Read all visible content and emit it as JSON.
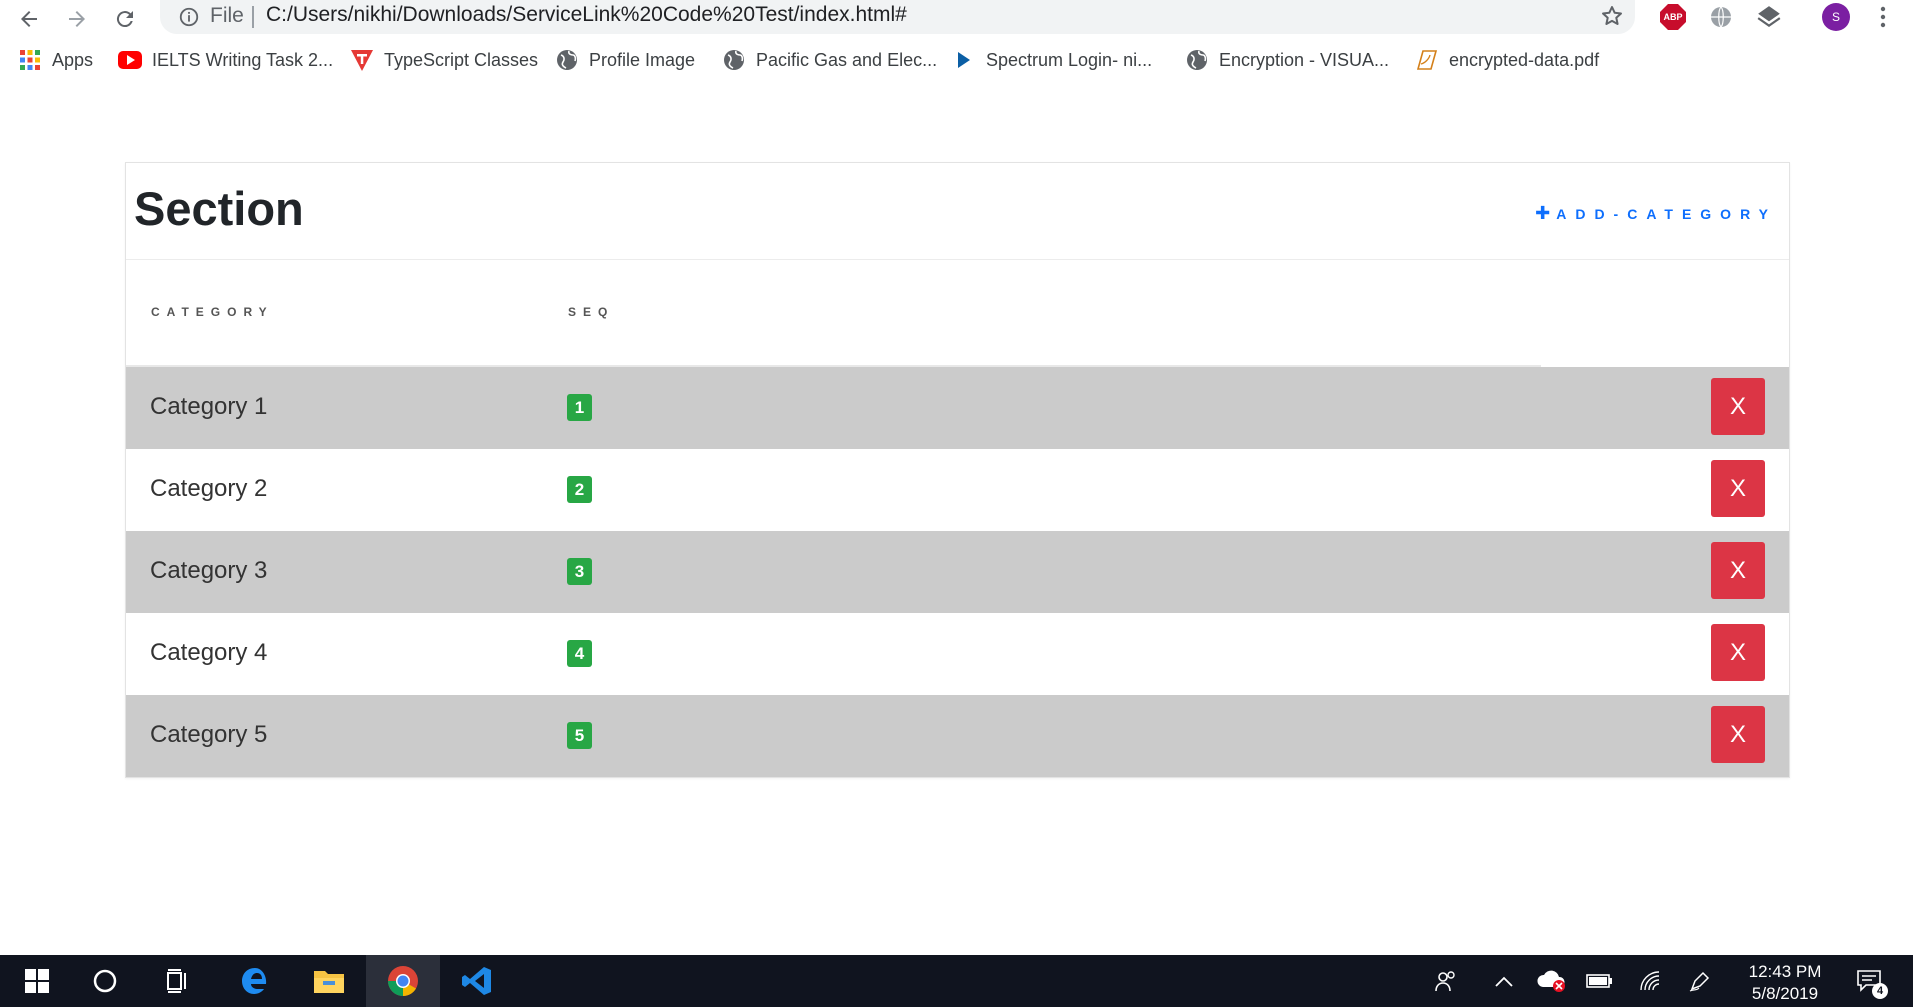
{
  "browser": {
    "file_label": "File",
    "url": "C:/Users/nikhi/Downloads/ServiceLink%20Code%20Test/index.html#",
    "extensions": {
      "abp_label": "ABP",
      "profile_initial": "S"
    }
  },
  "bookmarks": [
    {
      "label": "Apps",
      "icon": "apps-grid-icon"
    },
    {
      "label": "IELTS Writing Task 2...",
      "icon": "youtube-icon"
    },
    {
      "label": "TypeScript Classes",
      "icon": "typescript-t-icon"
    },
    {
      "label": "Profile Image",
      "icon": "globe-icon"
    },
    {
      "label": "Pacific Gas and Elec...",
      "icon": "globe-icon"
    },
    {
      "label": "Spectrum Login- ni...",
      "icon": "play-arrow-icon"
    },
    {
      "label": "Encryption - VISUA...",
      "icon": "globe-icon"
    },
    {
      "label": "encrypted-data.pdf",
      "icon": "pdf-file-icon"
    }
  ],
  "section": {
    "title": "Section",
    "add_category_label": "ADD-CATEGORY",
    "columns": {
      "category": "CATEGORY",
      "seq": "SEQ"
    },
    "rows": [
      {
        "name": "Category 1",
        "seq": "1",
        "delete_label": "X"
      },
      {
        "name": "Category 2",
        "seq": "2",
        "delete_label": "X"
      },
      {
        "name": "Category 3",
        "seq": "3",
        "delete_label": "X"
      },
      {
        "name": "Category 4",
        "seq": "4",
        "delete_label": "X"
      },
      {
        "name": "Category 5",
        "seq": "5",
        "delete_label": "X"
      }
    ]
  },
  "colors": {
    "accent_blue": "#0d6efd",
    "seq_badge_green": "#28a745",
    "delete_red": "#dc3545",
    "row_gray": "#cbcbcb"
  },
  "taskbar": {
    "time": "12:43 PM",
    "date": "5/8/2019",
    "notification_count": "4"
  }
}
